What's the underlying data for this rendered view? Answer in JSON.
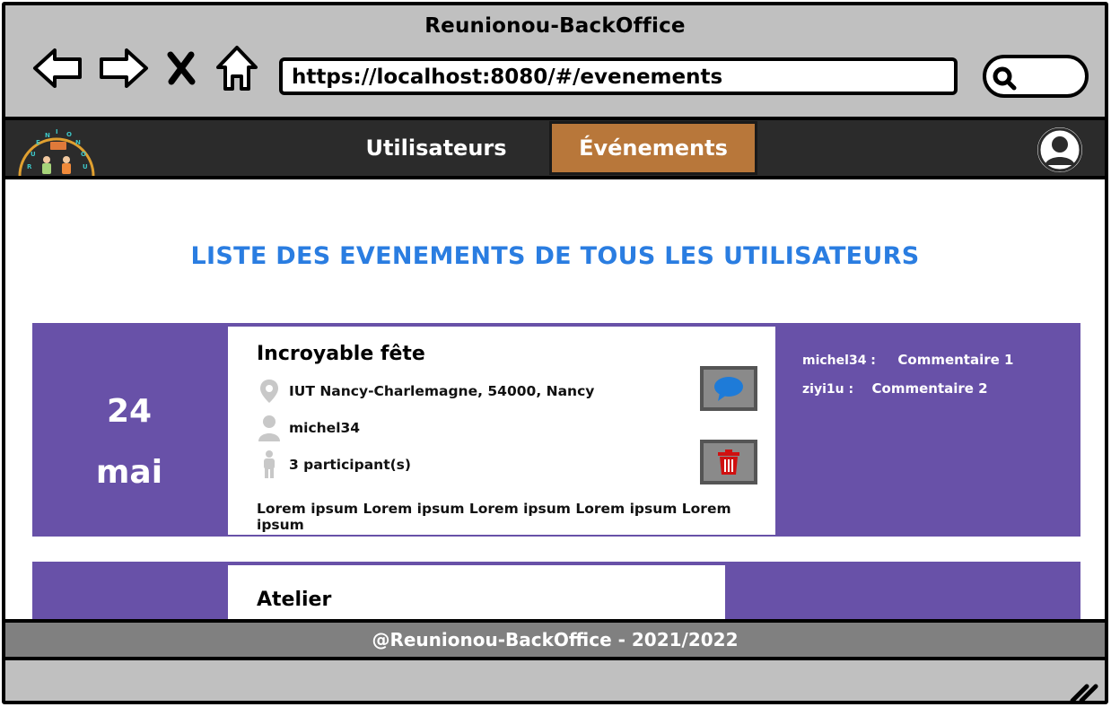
{
  "window": {
    "title": "Reunionou-BackOffice"
  },
  "browser": {
    "url": "https://localhost:8080/#/evenements",
    "icons": [
      "back-arrow-icon",
      "forward-arrow-icon",
      "close-icon",
      "home-icon",
      "search-icon"
    ]
  },
  "navbar": {
    "logo_letters": [
      "R",
      "E",
      "U",
      "N",
      "I",
      "O",
      "N",
      "O",
      "U"
    ],
    "items": [
      {
        "label": "Utilisateurs",
        "active": false
      },
      {
        "label": "Événements",
        "active": true
      }
    ],
    "active_color": "#b8773a"
  },
  "main": {
    "title": "LISTE DES EVENEMENTS DE TOUS LES UTILISATEURS",
    "title_color": "#2a7de1",
    "card_color": "#6851a8",
    "events": [
      {
        "day": "24",
        "month": "mai",
        "title": "Incroyable fête",
        "location": "IUT Nancy-Charlemagne, 54000, Nancy",
        "organizer": "michel34",
        "participants": "3 participant(s)",
        "description": "Lorem ipsum Lorem ipsum Lorem ipsum Lorem ipsum Lorem ipsum",
        "comments": [
          {
            "author": "michel34 :",
            "text": "Commentaire 1"
          },
          {
            "author": "ziyi1u :",
            "text": "Commentaire 2"
          }
        ]
      },
      {
        "title": "Atelier"
      }
    ]
  },
  "footer": {
    "text": "@Reunionou-BackOffice - 2021/2022"
  }
}
